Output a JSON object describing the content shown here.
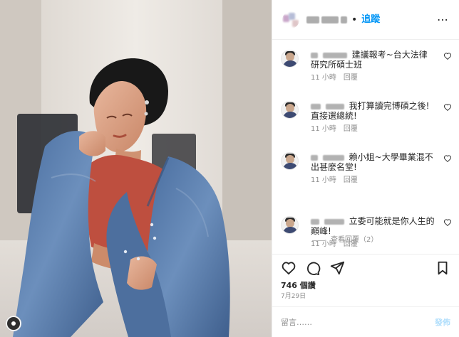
{
  "header": {
    "follow_label": "追蹤",
    "dot": "•"
  },
  "comments": [
    {
      "text": "建議報考~台大法律研究所碩士班",
      "time": "11 小時",
      "reply": "回覆"
    },
    {
      "text": "我打算讀完博碩之後!直接選總統!",
      "time": "11 小時",
      "reply": "回覆"
    },
    {
      "text": "賴小姐~大學畢業混不出甚麼名堂!",
      "time": "11 小時",
      "reply": "回覆"
    },
    {
      "text": "立委可能就是你人生的巔峰!",
      "time": "11 小時",
      "reply": "回覆"
    }
  ],
  "view_replies": "查看回覆（2）",
  "likes": "746 個讚",
  "date": "7月29日",
  "comment_box": {
    "placeholder": "留言……",
    "post_label": "發佈"
  },
  "colors": {
    "link_blue": "#0095f6",
    "muted_gray": "#8e8e8e",
    "disabled_post_blue": "#b2dffc"
  },
  "icons": {
    "like": "heart-icon",
    "comment": "comment-icon",
    "share": "send-icon",
    "save": "bookmark-icon"
  }
}
